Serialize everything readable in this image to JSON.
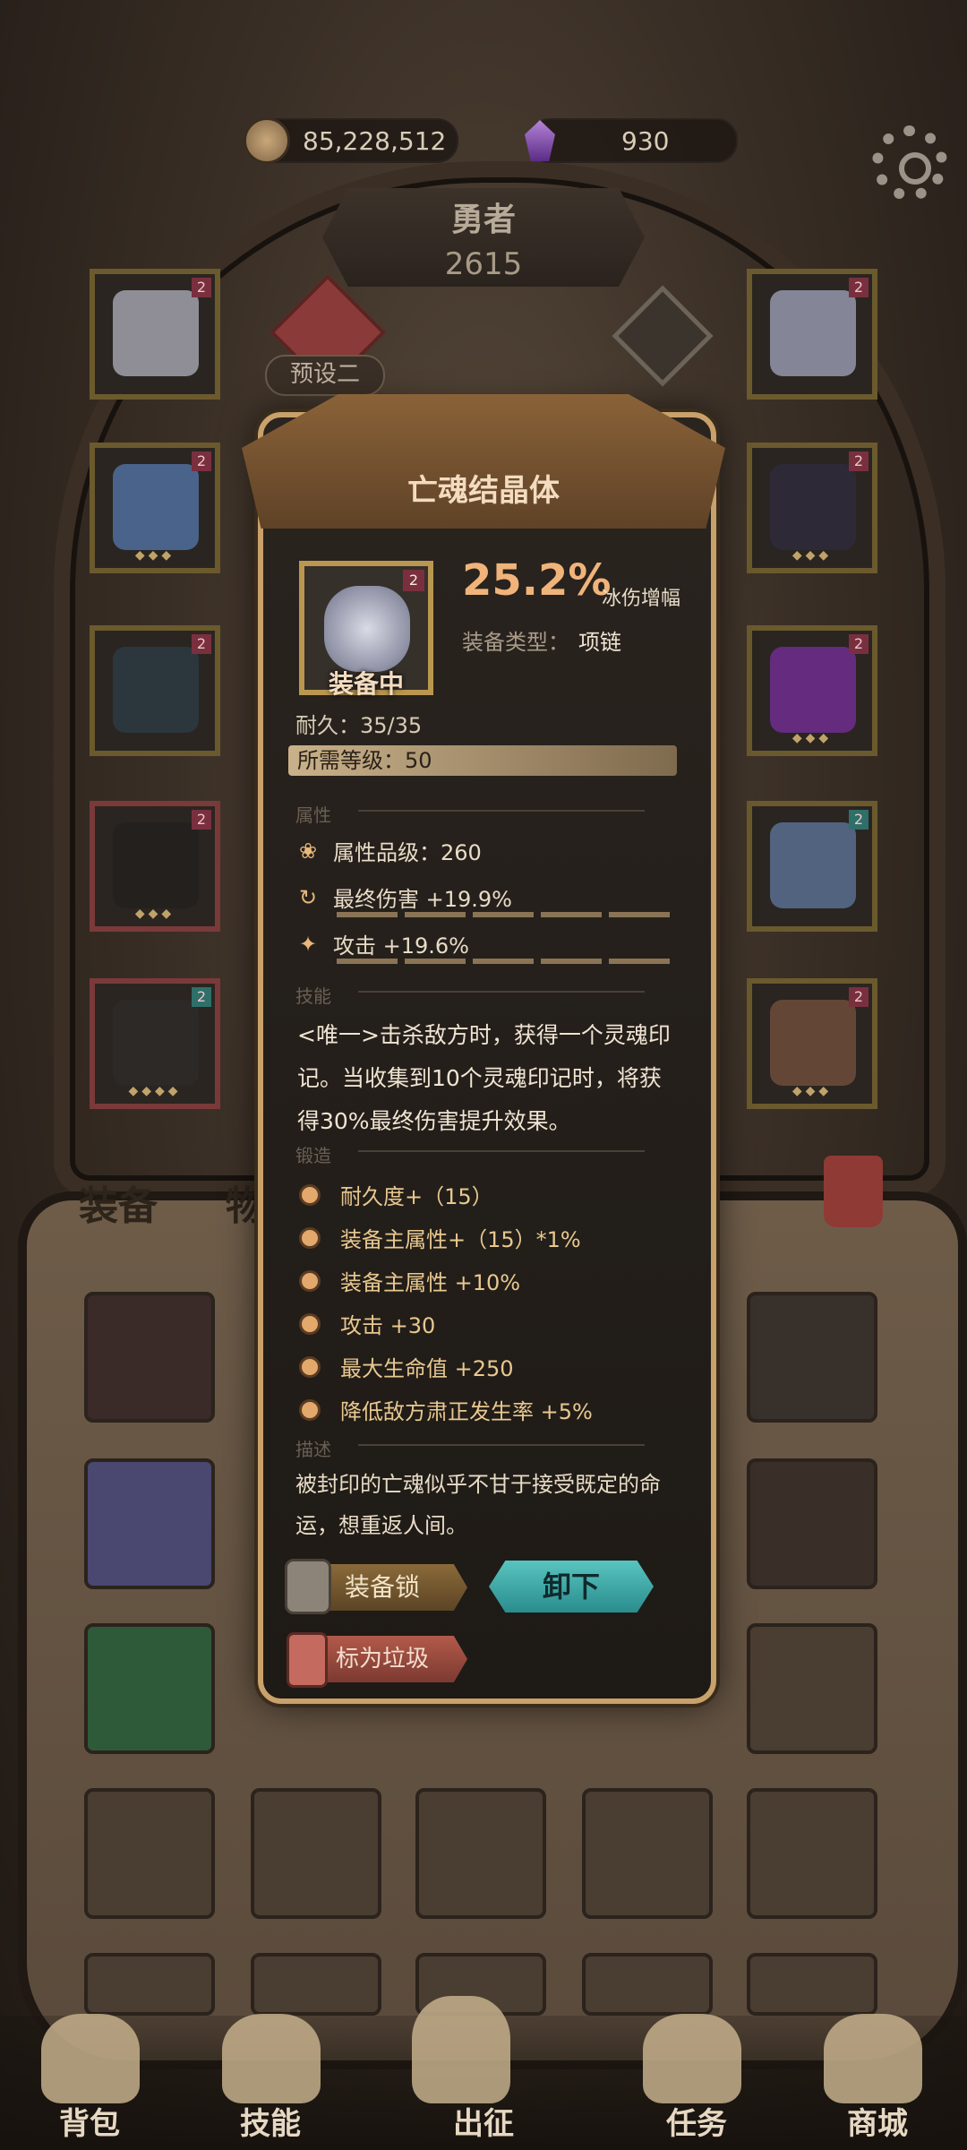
{
  "currency": {
    "coins": "85,228,512",
    "gems": "930"
  },
  "hero": {
    "name": "勇者",
    "power": "2615",
    "preset": "预设二"
  },
  "tabs": {
    "equip": "装备",
    "items": "物品"
  },
  "modal": {
    "title": "亡魂结晶体",
    "equipped_label": "装备中",
    "stat_percent": "25.2%",
    "stat_name": "冰伤增幅",
    "type_label": "装备类型：",
    "type_value": "项链",
    "durability": "耐久：35/35",
    "required_level": "所需等级：50",
    "sections": {
      "attributes": "属性",
      "skill": "技能",
      "forge": "锻造",
      "desc": "描述"
    },
    "attributes": [
      {
        "icon": "lotus-icon",
        "text": "属性品级：260"
      },
      {
        "icon": "cycle-icon",
        "text": "最终伤害 +19.9%"
      },
      {
        "icon": "sparkle-icon",
        "text": "攻击 +19.6%"
      }
    ],
    "skill_text": "<唯一>击杀敌方时，获得一个灵魂印记。当收集到10个灵魂印记时，将获得30%最终伤害提升效果。",
    "forge": [
      "耐久度+（15）",
      "装备主属性+（15）*1%",
      "装备主属性 +10%",
      "攻击 +30",
      "最大生命值 +250",
      "降低敌方肃正发生率 +5%"
    ],
    "description": "被封印的亡魂似乎不甘于接受既定的命运，想重返人间。",
    "buttons": {
      "lock": "装备锁",
      "unequip": "卸下",
      "junk": "标为垃圾"
    }
  },
  "nav": [
    "背包",
    "技能",
    "出征",
    "任务",
    "商城"
  ],
  "colors": {
    "accent": "#f0b47a",
    "teal": "#3aa6a4",
    "frame": "#c9a16a"
  }
}
